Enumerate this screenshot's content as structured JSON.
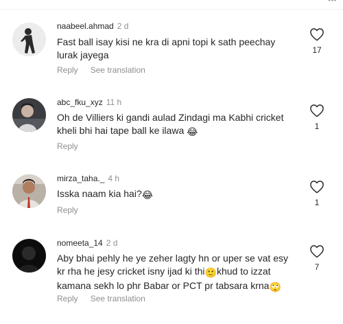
{
  "topbar": {
    "menu_icon": "more-dots-icon"
  },
  "comments": [
    {
      "username": "naabeel.ahmad",
      "time": "2 d",
      "text": "Fast ball isay kisi ne kra di apni topi k sath peechay lurak jayega",
      "reply_label": "Reply",
      "translation_label": "See translation",
      "likes": "17",
      "avatar_icon": "person-silhouette-icon"
    },
    {
      "username": "abc_fku_xyz",
      "time": "11 h",
      "text": "Oh de Villiers ki gandi aulad Zindagi ma Kabhi cricket kheli bhi hai tape ball ke ilawa",
      "text_emoji": "😂",
      "reply_label": "Reply",
      "likes": "1",
      "avatar_icon": "person-photo-icon"
    },
    {
      "username": "mirza_taha._",
      "time": "4 h",
      "text": "Isska naam kia hai?",
      "text_emoji": "😂",
      "reply_label": "Reply",
      "likes": "1",
      "avatar_icon": "person-photo-icon"
    },
    {
      "username": "nomeeta_14",
      "time": "2 d",
      "text_part1": "Aby bhai pehly he ye zeher lagty hn or uper se vat esy kr rha he jesy cricket isny ijad ki thi",
      "text_emoji1": "🙂",
      "text_part2": "khud to izzat kamana sekh lo phr Babar or PCT pr tabsara krna",
      "text_emoji2": "🙄",
      "reply_label": "Reply",
      "translation_label": "See translation",
      "likes": "7",
      "avatar_icon": "person-photo-icon"
    }
  ],
  "colors": {
    "secondary_text": "#8e8e8e",
    "primary_text": "#262626",
    "heart_stroke": "#262626"
  }
}
